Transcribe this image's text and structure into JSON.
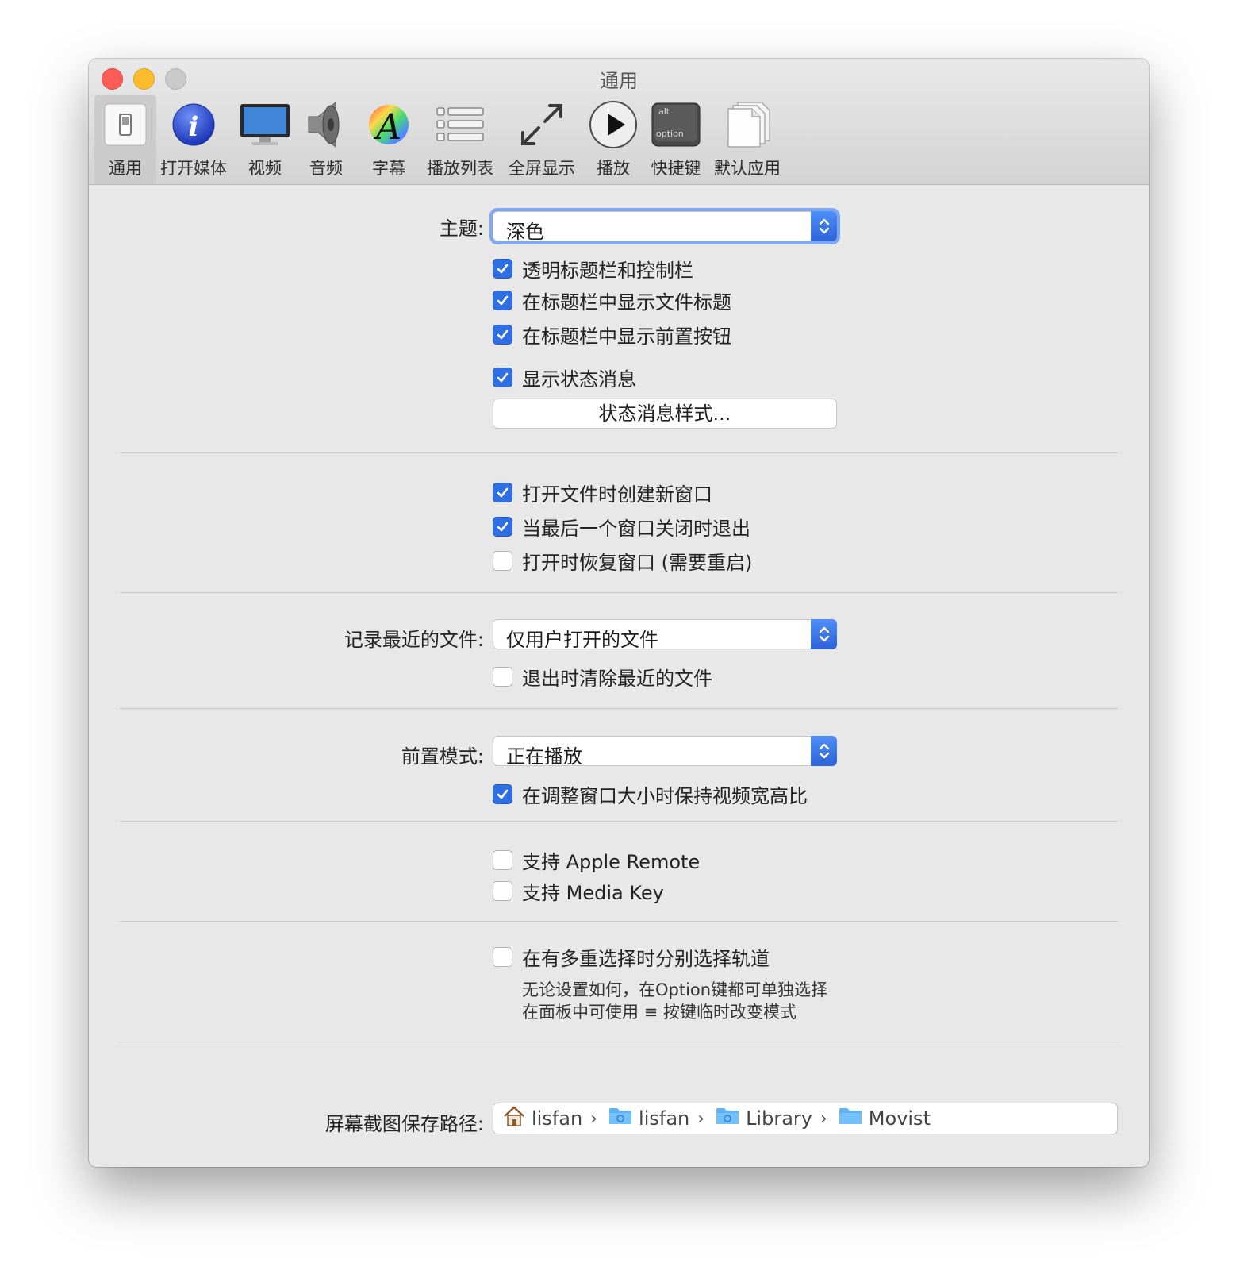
{
  "window": {
    "title": "通用"
  },
  "toolbar": {
    "items": [
      {
        "label": "通用",
        "icon": "switch-icon"
      },
      {
        "label": "打开媒体",
        "icon": "info-icon"
      },
      {
        "label": "视频",
        "icon": "monitor-icon"
      },
      {
        "label": "音频",
        "icon": "speaker-icon"
      },
      {
        "label": "字幕",
        "icon": "font-icon"
      },
      {
        "label": "播放列表",
        "icon": "list-icon"
      },
      {
        "label": "全屏显示",
        "icon": "fullscreen-icon"
      },
      {
        "label": "播放",
        "icon": "play-icon"
      },
      {
        "label": "快捷键",
        "icon": "option-key-icon"
      },
      {
        "label": "默认应用",
        "icon": "documents-icon"
      }
    ],
    "key_top": "alt",
    "key_bottom": "option"
  },
  "theme": {
    "label": "主题:",
    "value": "深色",
    "transparent_bar": {
      "label": "透明标题栏和控制栏",
      "checked": true
    },
    "show_file_title": {
      "label": "在标题栏中显示文件标题",
      "checked": true
    },
    "show_front_button": {
      "label": "在标题栏中显示前置按钮",
      "checked": true
    },
    "show_status": {
      "label": "显示状态消息",
      "checked": true
    },
    "status_style_button": "状态消息样式..."
  },
  "window_behavior": {
    "new_window": {
      "label": "打开文件时创建新窗口",
      "checked": true
    },
    "quit_on_close": {
      "label": "当最后一个窗口关闭时退出",
      "checked": true
    },
    "restore_windows": {
      "label": "打开时恢复窗口 (需要重启)",
      "checked": false
    }
  },
  "recent": {
    "label": "记录最近的文件:",
    "value": "仅用户打开的文件",
    "clear_on_quit": {
      "label": "退出时清除最近的文件",
      "checked": false
    }
  },
  "front": {
    "label": "前置模式:",
    "value": "正在播放",
    "keep_aspect": {
      "label": "在调整窗口大小时保持视频宽高比",
      "checked": true
    }
  },
  "remote": {
    "apple_remote": {
      "label": "支持 Apple Remote",
      "checked": false
    },
    "media_key": {
      "label": "支持 Media Key",
      "checked": false
    }
  },
  "tracks": {
    "separate": {
      "label": "在有多重选择时分别选择轨道",
      "checked": false
    },
    "hint1": "无论设置如何，在Option键都可单独选择",
    "hint2": "在面板中可使用 ≡ 按键临时改变模式"
  },
  "screenshot": {
    "label": "屏幕截图保存路径:",
    "path": [
      "lisfan",
      "lisfan",
      "Library",
      "Movist"
    ],
    "separator": "›"
  },
  "colors": {
    "accent": "#2f6fe4",
    "close": "#fc5d56",
    "minimize": "#fdbb2e"
  }
}
